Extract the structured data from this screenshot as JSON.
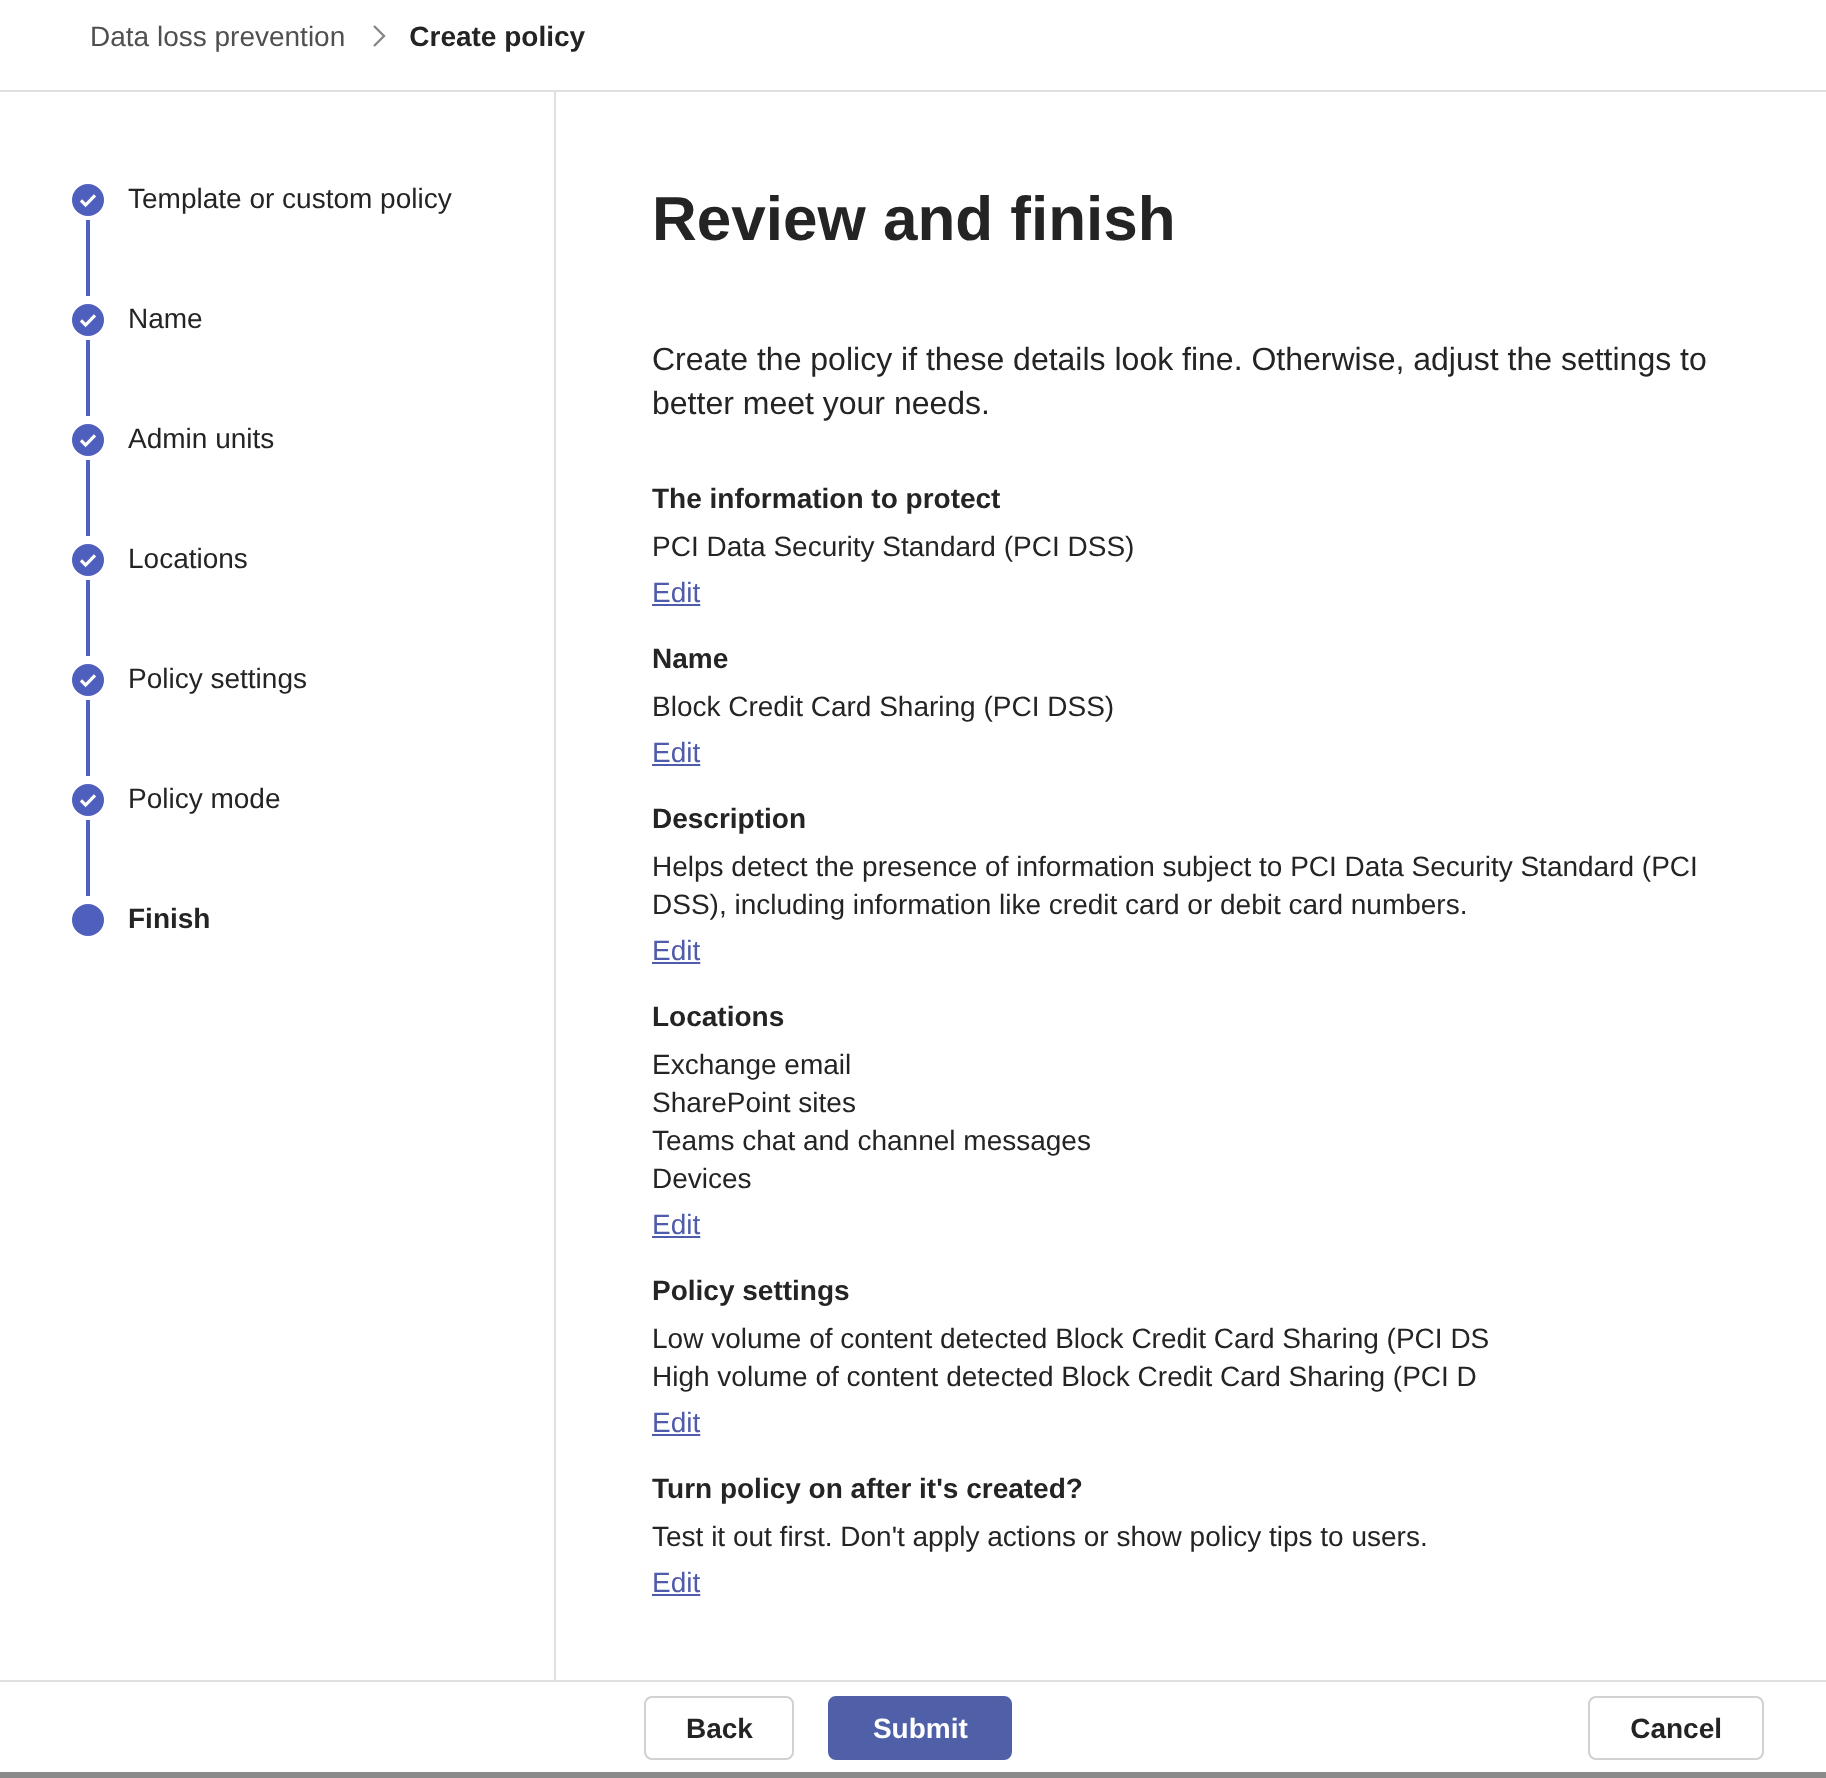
{
  "breadcrumb": [
    {
      "label": "Data loss prevention",
      "current": false
    },
    {
      "label": "Create policy",
      "current": true
    }
  ],
  "steps": [
    {
      "label": "Template or custom policy",
      "kind": "completed"
    },
    {
      "label": "Name",
      "kind": "completed"
    },
    {
      "label": "Admin units",
      "kind": "completed"
    },
    {
      "label": "Locations",
      "kind": "completed"
    },
    {
      "label": "Policy settings",
      "kind": "completed"
    },
    {
      "label": "Policy mode",
      "kind": "completed"
    },
    {
      "label": "Finish",
      "kind": "current"
    }
  ],
  "title": "Review and finish",
  "intro": "Create the policy if these details look fine. Otherwise, adjust the settings to better meet your needs.",
  "sections": [
    {
      "heading": "The information to protect",
      "lines": [
        "PCI Data Security Standard (PCI DSS)"
      ],
      "link": "Edit"
    },
    {
      "heading": "Name",
      "lines": [
        "Block Credit Card Sharing (PCI DSS)"
      ],
      "link": "Edit"
    },
    {
      "heading": "Description",
      "lines": [
        "Helps detect the presence of information subject to PCI Data Security Standard (PCI DSS), including information like credit card or debit card numbers."
      ],
      "link": "Edit"
    },
    {
      "heading": "Locations",
      "lines": [
        "Exchange email",
        "SharePoint sites",
        "Teams chat and channel messages",
        "Devices"
      ],
      "link": "Edit"
    },
    {
      "heading": "Policy settings",
      "lines": [
        "Low volume of content detected Block Credit Card Sharing (PCI DS",
        "High volume of content detected Block Credit Card Sharing (PCI D"
      ],
      "link": "Edit"
    },
    {
      "heading": "Turn policy on after it's created?",
      "lines": [
        "Test it out first. Don't apply actions or show policy tips to users."
      ],
      "link": "Edit"
    }
  ],
  "footer": {
    "buttons": [
      {
        "label": "Back",
        "kind": "secondary"
      },
      {
        "label": "Submit",
        "kind": "primary"
      }
    ],
    "cancel": "Cancel"
  }
}
